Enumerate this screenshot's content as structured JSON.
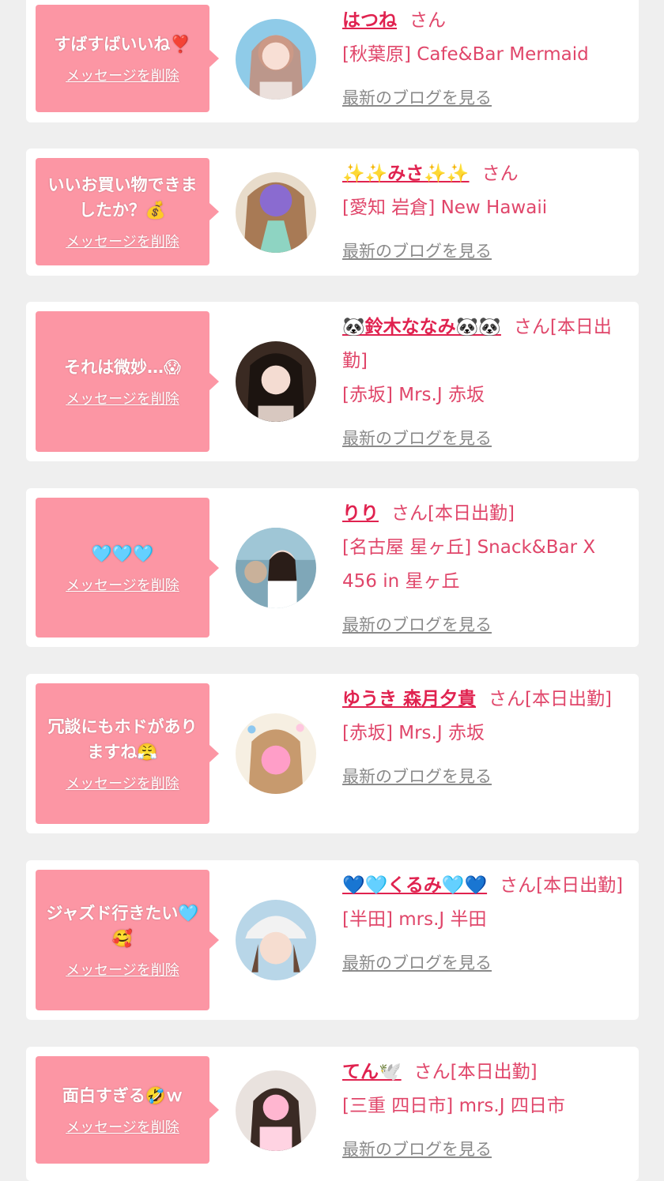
{
  "delete_label": "メッセージを削除",
  "blog_label": "最新のブログを見る",
  "colors": {
    "bubble": "#fc96a4",
    "name": "#e0224f",
    "text": "#e0466a",
    "link": "#8a8a8a",
    "background": "#efefef"
  },
  "cards": [
    {
      "message": "すばすばいいね❣️",
      "name": "はつね",
      "suffix": "さん",
      "shop": "[秋葉原] Cafe&Bar Mermaid",
      "avatar_icon": "profile-photo"
    },
    {
      "message": "いいお買い物できましたか？💰",
      "name": "✨✨みさ✨✨",
      "suffix": "さん",
      "shop": "[愛知 岩倉] New Hawaii",
      "avatar_icon": "profile-photo"
    },
    {
      "message": "それは微妙…😱",
      "name": "🐼鈴木ななみ🐼🐼",
      "suffix": "さん[本日出勤]",
      "shop": "[赤坂] Mrs.J 赤坂",
      "avatar_icon": "profile-photo"
    },
    {
      "message": "🩵🩵🩵",
      "name": "りり",
      "suffix": "さん[本日出勤]",
      "shop": "[名古屋 星ヶ丘] Snack&Bar X 456 in 星ヶ丘",
      "avatar_icon": "profile-photo"
    },
    {
      "message": "冗談にもホドがありますね😤",
      "name": "ゆうき 森月夕貴",
      "suffix": "さん[本日出勤]",
      "shop": "[赤坂] Mrs.J 赤坂",
      "avatar_icon": "profile-photo"
    },
    {
      "message": "ジャズド行きたい🩵🥰",
      "name": "💙🩵くるみ🩵💙",
      "suffix": "さん[本日出勤]",
      "shop": "[半田] mrs.J 半田",
      "avatar_icon": "profile-photo"
    },
    {
      "message": "面白すぎる🤣ｗ",
      "name": "てん🕊️",
      "suffix": "さん[本日出勤]",
      "shop": "[三重 四日市] mrs.J 四日市",
      "avatar_icon": "profile-photo"
    }
  ]
}
